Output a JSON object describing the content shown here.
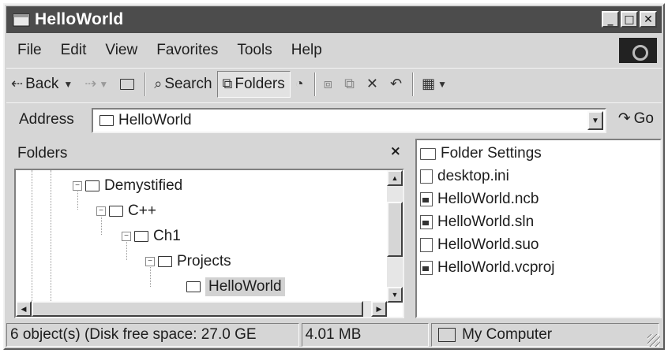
{
  "window": {
    "title": "HelloWorld"
  },
  "window_buttons": {
    "minimize": "_",
    "maximize": "□",
    "close": "✕"
  },
  "menu": [
    "File",
    "Edit",
    "View",
    "Favorites",
    "Tools",
    "Help"
  ],
  "toolbar": {
    "back_label": "Back",
    "search_label": "Search",
    "folders_label": "Folders"
  },
  "address": {
    "label": "Address",
    "value": "HelloWorld",
    "go_label": "Go"
  },
  "folders_pane": {
    "title": "Folders",
    "close_glyph": "×",
    "tree": [
      {
        "label": "Demystified",
        "expander": "−"
      },
      {
        "label": "C++",
        "expander": "−"
      },
      {
        "label": "Ch1",
        "expander": "−"
      },
      {
        "label": "Projects",
        "expander": "−"
      },
      {
        "label": "HelloWorld",
        "expander": ""
      }
    ]
  },
  "files": [
    {
      "name": "Folder Settings",
      "icon": "folder-icon"
    },
    {
      "name": "desktop.ini",
      "icon": "file-icon"
    },
    {
      "name": "HelloWorld.ncb",
      "icon": "file-icon"
    },
    {
      "name": "HelloWorld.sln",
      "icon": "solution-icon"
    },
    {
      "name": "HelloWorld.suo",
      "icon": "file-icon"
    },
    {
      "name": "HelloWorld.vcproj",
      "icon": "file-icon"
    }
  ],
  "status": {
    "objects": "6 object(s) (Disk free space: 27.0 GE",
    "size": "4.01 MB",
    "zone": "My Computer"
  }
}
